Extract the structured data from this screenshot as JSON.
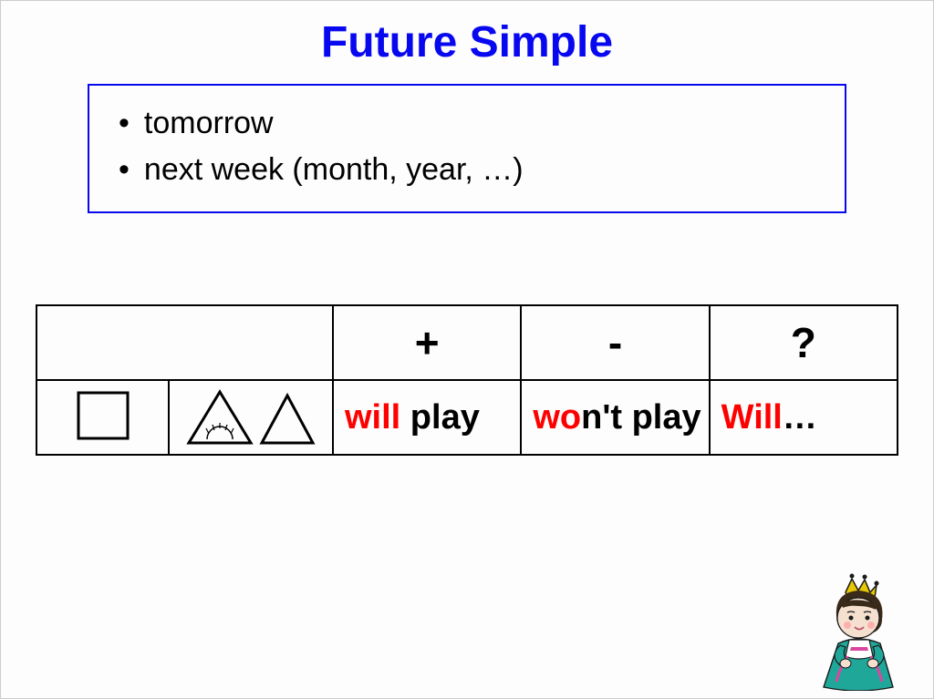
{
  "title": "Future Simple",
  "bullets": {
    "line1": "tomorrow",
    "line2": "next week (month, year, …)"
  },
  "table": {
    "headers": {
      "plus": "+",
      "minus": "-",
      "question": "?"
    },
    "row": {
      "affirmative": {
        "aux": "will ",
        "verb": "play"
      },
      "negative": {
        "aux": "wo",
        "rest": "n't play"
      },
      "interrogative": {
        "aux": "Will",
        "rest": "…"
      }
    }
  }
}
